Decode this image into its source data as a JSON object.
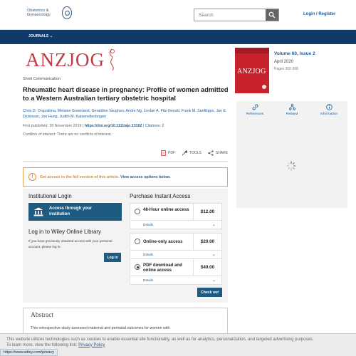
{
  "header": {
    "logo_line1": "Obstetrics &",
    "logo_line2": "Gynaecology",
    "search_placeholder": "Search",
    "login_label": "Login / Register"
  },
  "nav": {
    "journals_label": "JOURNALS"
  },
  "journal": {
    "banner_name": "ANZJOG"
  },
  "article": {
    "type": "Short Communication",
    "title": "Rheumatic heart disease in pregnancy: Profile of women admitted to a Western Australian tertiary obstetric hospital",
    "authors": "Chris D. Ongzalima, Melanie Greenland, Geraldine Vaughan, Andre Ng, Jordan A. Fitz-Gerald, Frank M. Sanfilippo, Jan E. Dickinson, Joe Hung, Judith M. Katzenellenbogen",
    "first_published_label": "First published:",
    "first_published_date": "28 November 2019",
    "doi": "https://doi.org/10.1111/ajo.13102",
    "citations": "Citations: 2",
    "coi_label": "Conflicts of interest:",
    "coi_text": "There are no conflicts of interest."
  },
  "tools": {
    "pdf": "PDF",
    "tools": "TOOLS",
    "share": "SHARE"
  },
  "access_alert": {
    "text": "Get access to the full version of this article.",
    "link": "View access options below."
  },
  "institutional": {
    "heading": "Institutional Login",
    "button": "Access through your institution"
  },
  "wol": {
    "heading": "Log in to Wiley Online Library",
    "text": "If you have previously obtained access with your personal account, please log in.",
    "button": "Log in"
  },
  "purchase": {
    "heading": "Purchase Instant Access",
    "options": [
      {
        "label": "48-Hour online access",
        "price": "$12.00",
        "details": "Details",
        "checked": false
      },
      {
        "label": "Online-only access",
        "price": "$20.00",
        "details": "Details",
        "checked": false
      },
      {
        "label": "PDF download and online access",
        "price": "$49.00",
        "details": "Details",
        "checked": true
      }
    ],
    "checkout": "Check out"
  },
  "abstract": {
    "heading": "Abstract",
    "text": "This retrospective study assessed maternal and perinatal outcomes for women with"
  },
  "issue": {
    "cover_title": "ANZJOG",
    "volume": "Volume 60, Issue 2",
    "date": "April 2020",
    "pages": "Pages 302-308"
  },
  "sidebar_tabs": {
    "references": "References",
    "related": "Related",
    "information": "Information"
  },
  "cookie": {
    "text1": "This website utilizes technologies such as cookies to enable essential site functionality, as well as for analytics, personalization, and targeted advertising purposes.",
    "text2": "To learn more, view the following link:",
    "link": "Privacy Policy"
  },
  "status_url": "https://www.wiley.com/privacy",
  "colors": {
    "navy": "#103a68",
    "brand_red": "#c03c44",
    "link_blue": "#1c5d99",
    "alert_orange": "#e08a2c",
    "button_blue": "#1f5b80"
  }
}
